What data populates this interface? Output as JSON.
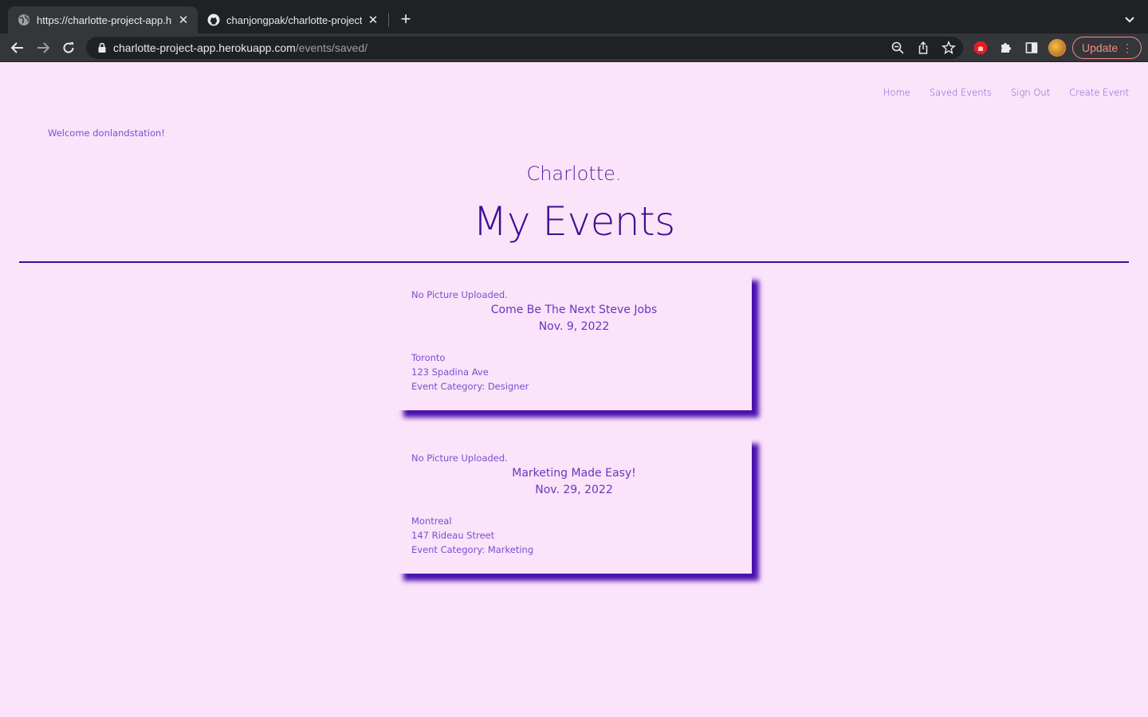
{
  "browser": {
    "tabs": [
      {
        "title": "https://charlotte-project-app.h",
        "active": true,
        "icon": "globe-icon"
      },
      {
        "title": "chanjongpak/charlotte-project",
        "active": false,
        "icon": "github-icon"
      }
    ],
    "new_tab_label": "+",
    "url_host": "charlotte-project-app.herokuapp.com",
    "url_path": "/events/saved/",
    "update_label": "Update"
  },
  "nav": {
    "items": [
      "Home",
      "Saved Events",
      "Sign Out",
      "Create Event"
    ]
  },
  "welcome": "Welcome donlandstation!",
  "brand": "Charlotte.",
  "heading": "My Events",
  "events": [
    {
      "picture_text": "No Picture Uploaded.",
      "title": "Come Be The Next Steve Jobs",
      "date": "Nov. 9, 2022",
      "city": "Toronto",
      "address": "123 Spadina Ave",
      "category": "Event Category: Designer"
    },
    {
      "picture_text": "No Picture Uploaded.",
      "title": "Marketing Made Easy!",
      "date": "Nov. 29, 2022",
      "city": "Montreal",
      "address": "147 Rideau Street",
      "category": "Event Category: Marketing"
    }
  ],
  "colors": {
    "page_bg": "#fbe3f9",
    "accent": "#3d0e91",
    "link": "#7b4ed0",
    "card_shadow": "#4b0fae"
  }
}
